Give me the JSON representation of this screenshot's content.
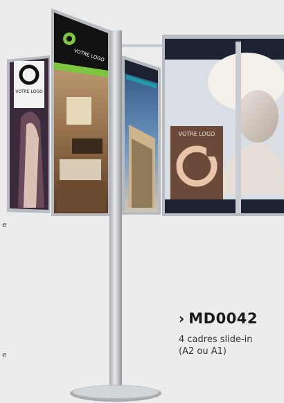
{
  "product": {
    "code": "MD0042",
    "chevron": "›",
    "description": "4 cadres slide-in\n(A2 ou A1)"
  },
  "panels": {
    "panel1_logo_text": "VOTRE LOGO",
    "panel2_logo_text": "VOTRE LOGO",
    "panel4_logo_text": "VOTRE LOGO"
  },
  "colors": {
    "background": "#ececec",
    "frame": "#b8bcc0",
    "pole": "#c9ccd0",
    "green_accent": "#7ec540",
    "dark_band": "#1d2233",
    "teal_accent": "#1f9aa6",
    "brown_sign": "#6b4a3a"
  }
}
